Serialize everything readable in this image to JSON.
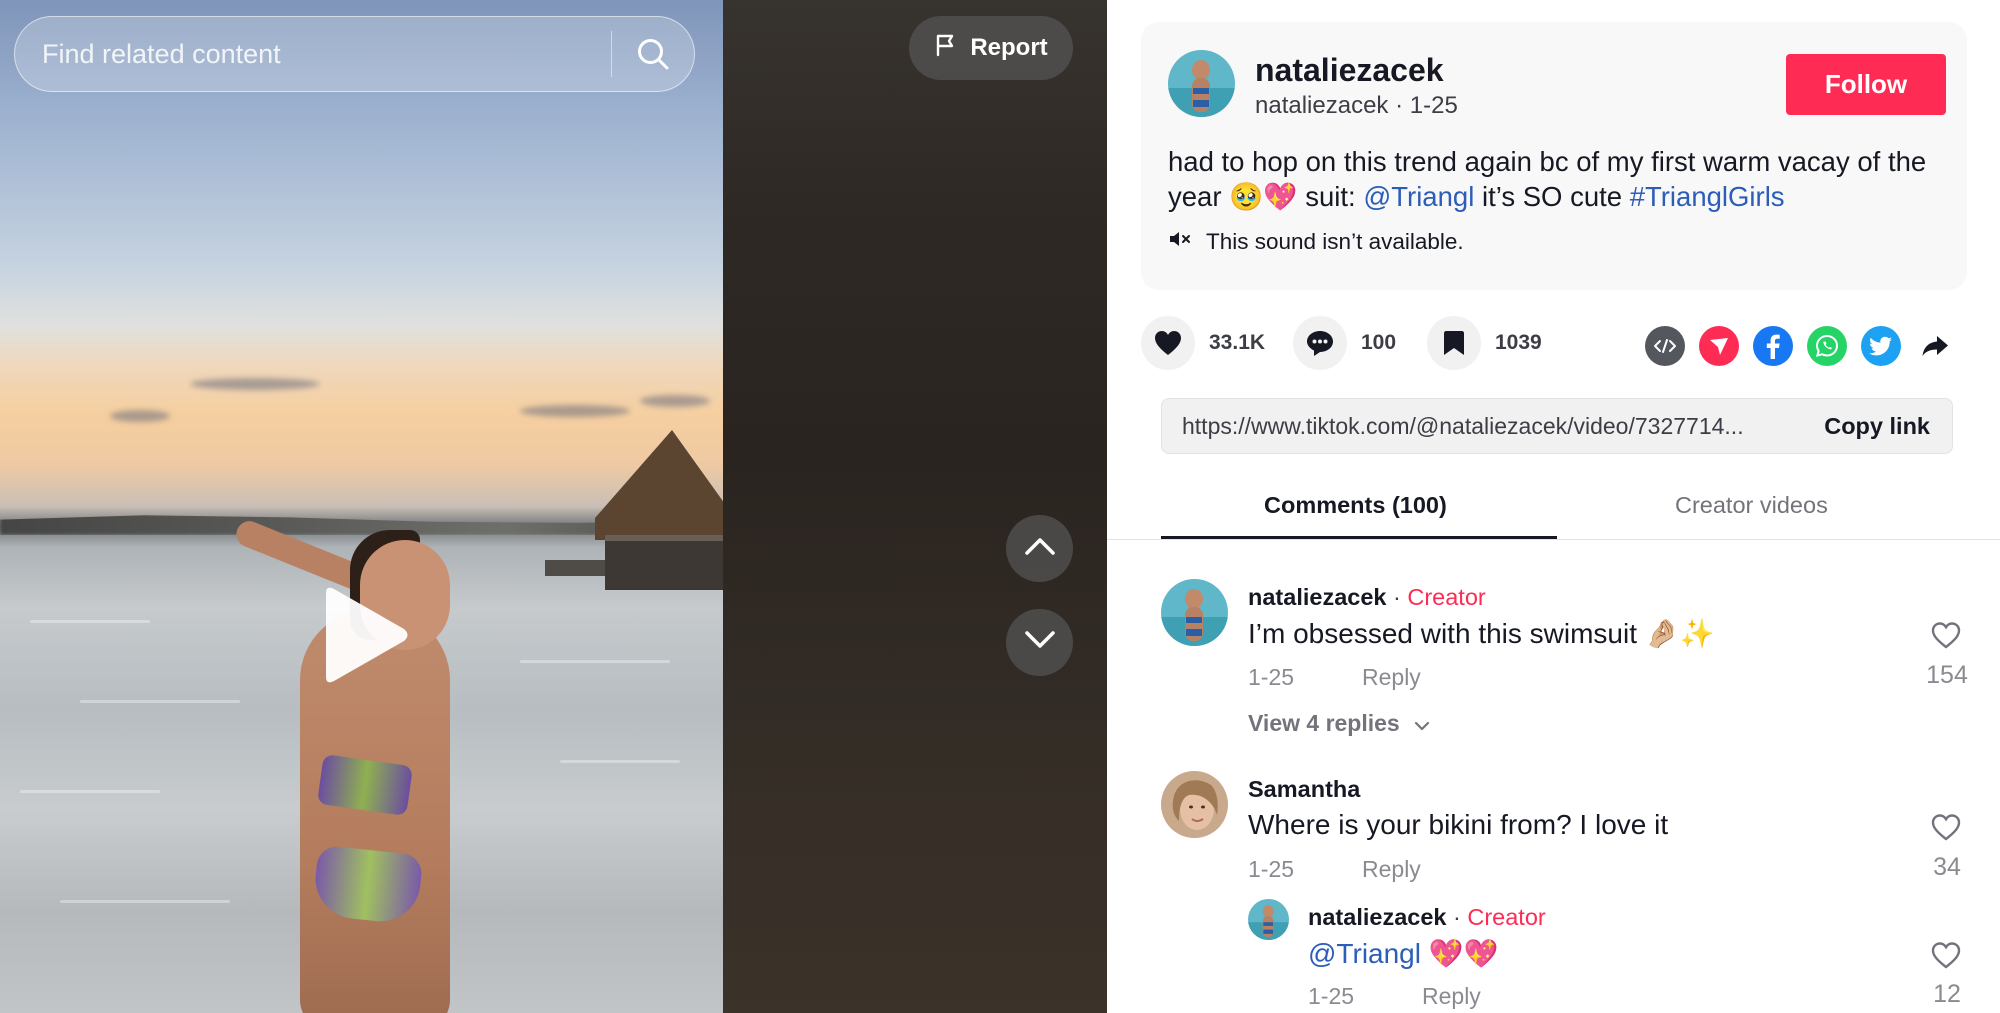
{
  "search": {
    "placeholder": "Find related content"
  },
  "report": {
    "label": "Report"
  },
  "post": {
    "author_name": "nataliezacek",
    "author_handle": "nataliezacek",
    "date": "1-25",
    "meta_separator": " · ",
    "follow_label": "Follow",
    "caption_text": "had to hop on this trend again bc of my first warm vacay of the year 🥹💖 suit: ",
    "caption_mention": "@Triangl",
    "caption_middle": " it’s SO cute ",
    "caption_hashtag": "#TrianglGirls",
    "sound_text": "This sound isn’t available."
  },
  "actions": {
    "likes": "33.1K",
    "comments": "100",
    "saves": "1039",
    "share_icons": [
      "embed-icon",
      "send-icon",
      "facebook-icon",
      "whatsapp-icon",
      "twitter-icon",
      "share-arrow-icon"
    ]
  },
  "link": {
    "url": "https://www.tiktok.com/@nataliezacek/video/7327714...",
    "copy_label": "Copy link"
  },
  "tabs": [
    {
      "label": "Comments (100)",
      "active": true
    },
    {
      "label": "Creator videos",
      "active": false
    }
  ],
  "comments": [
    {
      "author": "nataliezacek",
      "badge": "Creator",
      "text": "I’m obsessed with this swimsuit 🤌🏼✨",
      "date": "1-25",
      "reply_label": "Reply",
      "likes": "154",
      "view_replies": "View 4 replies"
    },
    {
      "author": "Samantha",
      "text": "Where is your bikini from? I love it",
      "date": "1-25",
      "reply_label": "Reply",
      "likes": "34"
    },
    {
      "author": "nataliezacek",
      "badge": "Creator",
      "mention": "@Triangl",
      "text": " 💖💖",
      "date": "1-25",
      "reply_label": "Reply",
      "likes": "12"
    }
  ],
  "colors": {
    "accent": "#fe2c55",
    "link": "#2b5db9",
    "text": "#161823",
    "muted": "#8a8b91"
  }
}
